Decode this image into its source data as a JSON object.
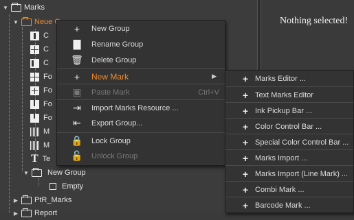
{
  "tree": {
    "root": {
      "label": "Marks"
    },
    "selected": {
      "label": "Neue G"
    },
    "children": [
      {
        "label": "C"
      },
      {
        "label": "C"
      },
      {
        "label": "C"
      },
      {
        "label": "Fo"
      },
      {
        "label": "Fo"
      },
      {
        "label": "Fo"
      },
      {
        "label": "Fo"
      },
      {
        "label": "M"
      },
      {
        "label": "M"
      },
      {
        "label": "Te"
      }
    ],
    "new_group": {
      "label": "New Group",
      "child": "Empty"
    },
    "ptr_marks": {
      "label": "PtR_Marks"
    },
    "next": {
      "label": "Report"
    }
  },
  "detail": {
    "message": "Nothing selected!"
  },
  "context_menu": {
    "items": [
      {
        "label": "New Group",
        "icon": "plus-icon",
        "glyph": "+"
      },
      {
        "label": "Rename Group",
        "icon": "folder-rename-icon",
        "glyph": "▇"
      },
      {
        "label": "Delete Group",
        "icon": "trash-icon",
        "glyph": "🗑"
      },
      {
        "label": "New Mark",
        "icon": "plus-icon",
        "glyph": "+"
      },
      {
        "label": "Paste Mark",
        "icon": "paste-icon",
        "glyph": "▣",
        "shortcut": "Ctrl+V"
      },
      {
        "label": "Import Marks Resource ...",
        "icon": "import-icon",
        "glyph": "⇥"
      },
      {
        "label": "Export Group...",
        "icon": "export-icon",
        "glyph": "⇤"
      },
      {
        "label": "Lock Group",
        "icon": "lock-icon",
        "glyph": "🔒"
      },
      {
        "label": "Unlock Group",
        "icon": "unlock-icon",
        "glyph": "🔓"
      }
    ]
  },
  "submenu": {
    "items": [
      {
        "label": "Marks Editor ..."
      },
      {
        "label": "Text Marks Editor"
      },
      {
        "label": "Ink Pickup Bar ..."
      },
      {
        "label": "Color Control Bar ..."
      },
      {
        "label": "Special Color Control Bar ..."
      },
      {
        "label": "Marks Import ..."
      },
      {
        "label": "Marks Import (Line Mark) ..."
      },
      {
        "label": "Combi Mark ..."
      },
      {
        "label": "Barcode Mark ..."
      }
    ]
  },
  "colors": {
    "highlight": "#ee8a2a",
    "menu_bg": "#333333",
    "panel_bg": "#3c3c3c"
  }
}
